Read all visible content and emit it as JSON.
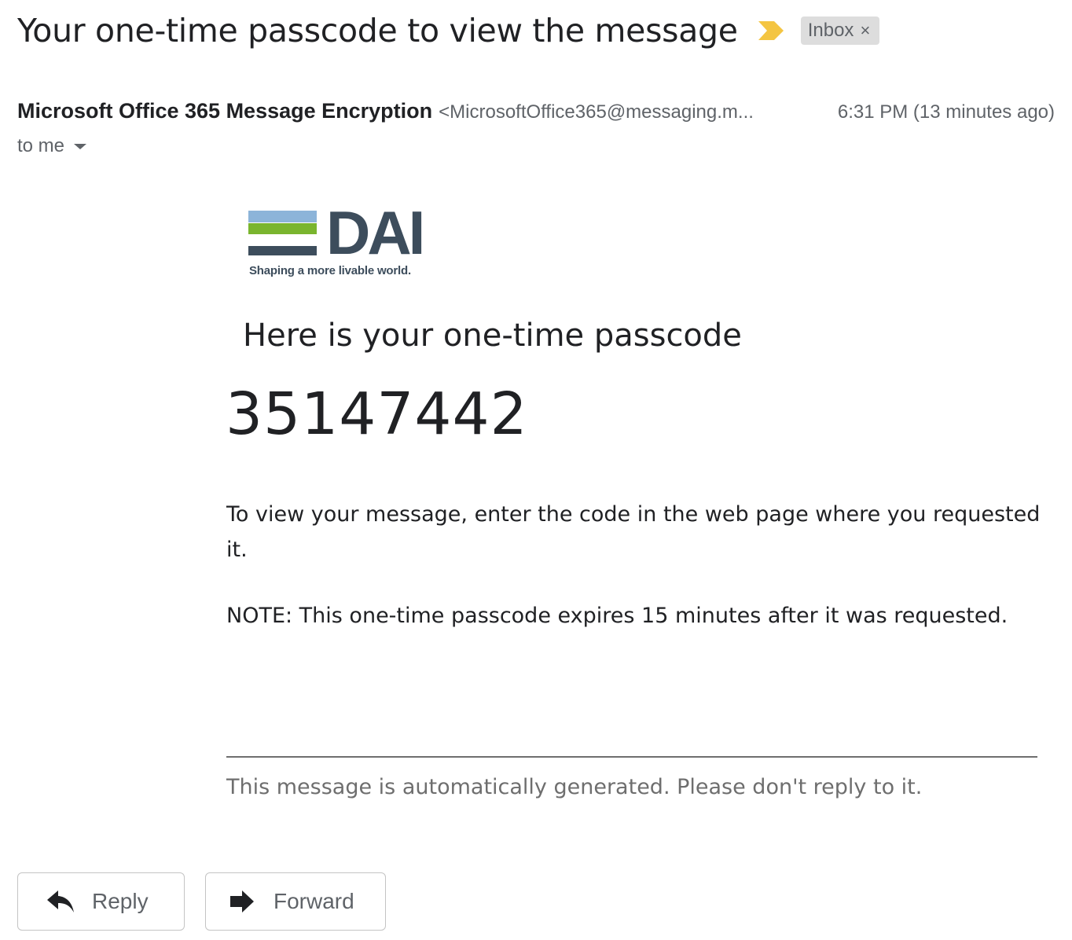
{
  "header": {
    "subject": "Your one-time passcode to view the message",
    "label": "Inbox",
    "label_remove": "×",
    "importance_icon": "important-marker-icon",
    "importance_color": "#f4c542"
  },
  "sender": {
    "name": "Microsoft Office 365 Message Encryption",
    "email": "<MicrosoftOffice365@messaging.m...",
    "timestamp": "6:31 PM (13 minutes ago)",
    "recipients": "to me"
  },
  "body": {
    "logo": {
      "wordmark": "DAI",
      "tagline": "Shaping a more livable world.",
      "colors": {
        "top": "#8cb4d9",
        "middle": "#7ab52e",
        "base": "#3d4d5c"
      }
    },
    "intro": "Here is your one-time passcode",
    "passcode": "35147442",
    "instruction": "To view your message, enter the code in the web page where you requested it.",
    "note": "NOTE: This one-time passcode expires 15 minutes after it was requested.",
    "auto_note": "This message is automatically generated. Please don't reply to it."
  },
  "actions": {
    "reply_label": "Reply",
    "reply_icon": "reply-arrow-icon",
    "forward_label": "Forward",
    "forward_icon": "forward-arrow-icon"
  }
}
